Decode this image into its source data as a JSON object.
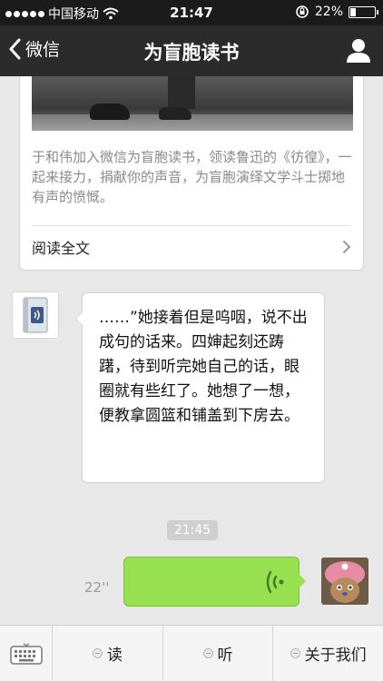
{
  "status_bar": {
    "carrier": "中国移动",
    "time": "21:47",
    "battery": "22%",
    "battery_level": 0.22
  },
  "nav": {
    "back_label": "微信",
    "title": "为盲胞读书",
    "icons": [
      "chevron-left-icon",
      "person-icon"
    ]
  },
  "article": {
    "summary": "于和伟加入微信为盲胞读书，领读鲁迅的《彷徨》，一起来接力，捐献你的声音，为盲胞演绎文学斗士掷地有声的愤慨。",
    "read_full": "阅读全文"
  },
  "messages": {
    "incoming_text": "……”她接着但是呜咽，说不出成句的话来。四婶起刻还踌躇，待到听完她自己的话，眼圈就有些红了。她想了一想，便教拿圆篮和铺盖到下房去。",
    "timestamp": "21:45",
    "voice_duration": "22''"
  },
  "bottom_menu": {
    "items": [
      "读",
      "听",
      "关于我们"
    ]
  },
  "colors": {
    "nav_bg": "#2b2b2b",
    "voice_bubble": "#97e04f",
    "chat_bg": "#e8e8e8"
  }
}
